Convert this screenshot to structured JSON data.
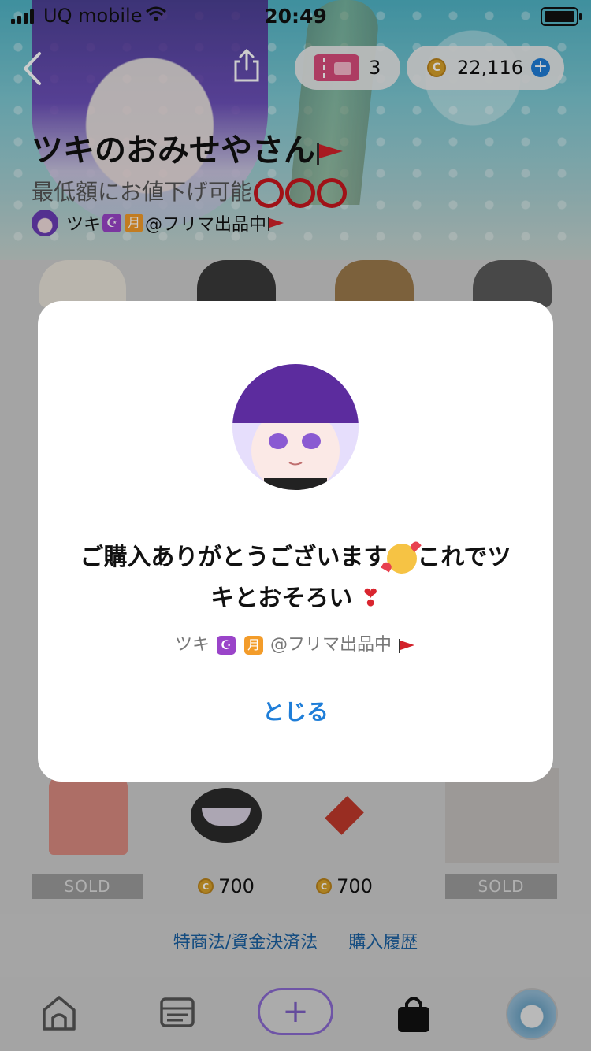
{
  "status_bar": {
    "carrier": "UQ mobile",
    "time": "20:49"
  },
  "header": {
    "ticket_count": "3",
    "coin_balance": "22,116",
    "shop_title": "ツキのおみせやさん",
    "shop_subtitle": "最低額にお値下げ可能",
    "owner_name_prefix": "ツキ",
    "owner_moon_glyph": "☪",
    "owner_month_glyph": "月",
    "owner_name_suffix": "@フリマ出品中"
  },
  "products_bottom": [
    {
      "status": "SOLD",
      "price": null
    },
    {
      "status": null,
      "price": "700"
    },
    {
      "status": null,
      "price": "700"
    },
    {
      "status": "SOLD",
      "price": null
    }
  ],
  "footer_links": {
    "legal": "特商法/資金決済法",
    "history": "購入履歴"
  },
  "modal": {
    "message_part1": "ご購入ありがとうございます",
    "message_part2": "これでツ",
    "message_part3": "キとおそろい",
    "heart_glyph": "❣",
    "owner_name_prefix": "ツキ",
    "owner_moon_glyph": "☪",
    "owner_month_glyph": "月",
    "owner_name_suffix": "@フリマ出品中",
    "close_label": "とじる"
  },
  "tab_bar": {
    "add_glyph": "+"
  },
  "colors": {
    "accent_blue": "#1f7ed8",
    "flag_red": "#d2212a",
    "coin_gold": "#d6a02a"
  },
  "icons": [
    "back-chevron-icon",
    "share-icon",
    "ticket-icon",
    "coin-icon",
    "plus-circle-icon",
    "home-icon",
    "list-icon",
    "add-icon",
    "shop-bag-icon",
    "profile-avatar"
  ]
}
